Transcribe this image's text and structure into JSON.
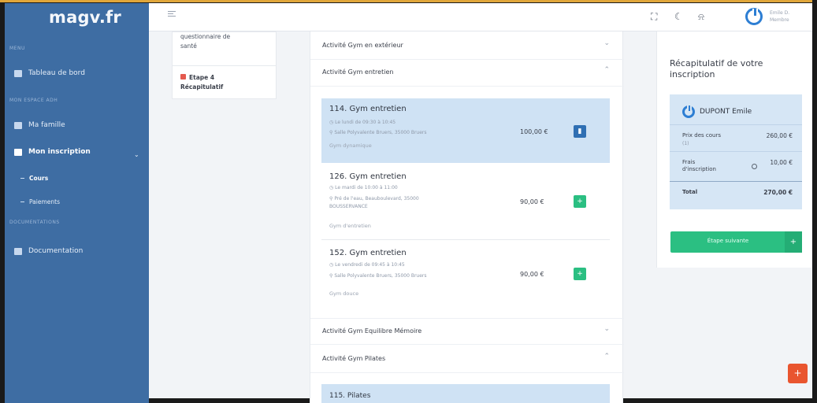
{
  "brand": "magv.fr",
  "sidebar": {
    "sections": [
      "MENU",
      "MON ESPACE ADH",
      "DOCUMENTATIONS"
    ],
    "items": [
      {
        "label": "Tableau de bord"
      },
      {
        "label": "Ma famille"
      },
      {
        "label": "Mon inscription"
      },
      {
        "label": "Documentation"
      }
    ],
    "subitems": [
      {
        "label": "Cours"
      },
      {
        "label": "Paiements"
      }
    ]
  },
  "topbar": {
    "user_line1": "Emile D.",
    "user_line2": "Membre"
  },
  "steps": {
    "previous_line1": "questionnaire de",
    "previous_line2": "santé",
    "current_line1": "Etape 4",
    "current_line2": "Récapitulatif"
  },
  "accordions": [
    {
      "label": "Activité Gym en extérieur"
    },
    {
      "label": "Activité Gym entretien"
    },
    {
      "label": "Activité Gym Equilibre Mémoire"
    },
    {
      "label": "Activité Gym Pilates"
    }
  ],
  "courses": [
    {
      "title": "114. Gym entretien",
      "when": "Le lundi de 09:30 à 10:45",
      "where": "Salle Polyvalente Bruers, 35000 Bruers",
      "where2": "",
      "tag": "Gym dynamique",
      "price": "100,00 €",
      "action": "delete"
    },
    {
      "title": "126. Gym entretien",
      "when": "Le mardi de 10:00 à 11:00",
      "where": "Pré de l'eau, Beauboulevard, 35000",
      "where2": "BOUSSERVANCE",
      "tag": "Gym d'entretien",
      "price": "90,00 €",
      "action": "add"
    },
    {
      "title": "152. Gym entretien",
      "when": "Le vendredi de 09:45 à 10:45",
      "where": "Salle Polyvalente Bruers, 35000 Bruers",
      "where2": "",
      "tag": "Gym douce",
      "price": "90,00 €",
      "action": "add"
    },
    {
      "title": "115. Pilates"
    }
  ],
  "recap": {
    "heading": "Récapitulatif de votre inscription",
    "name": "DUPONT Emile",
    "course_label": "Prix des cours",
    "course_sub": "(1)",
    "course_value": "260,00 €",
    "fees_label_1": "Frais",
    "fees_label_2": "d'inscription",
    "fees_value": "10,00 €",
    "total_label": "Total",
    "total_value": "270,00 €",
    "cta_label": "Étape suivante",
    "cta_plus": "+"
  },
  "fab_icon": "+",
  "colors": {
    "sidebar": "#3e6da3",
    "accent_blue": "#2d7ed3",
    "selected": "#cfe2f4",
    "green": "#2bbf82",
    "orange": "#e9552f"
  }
}
